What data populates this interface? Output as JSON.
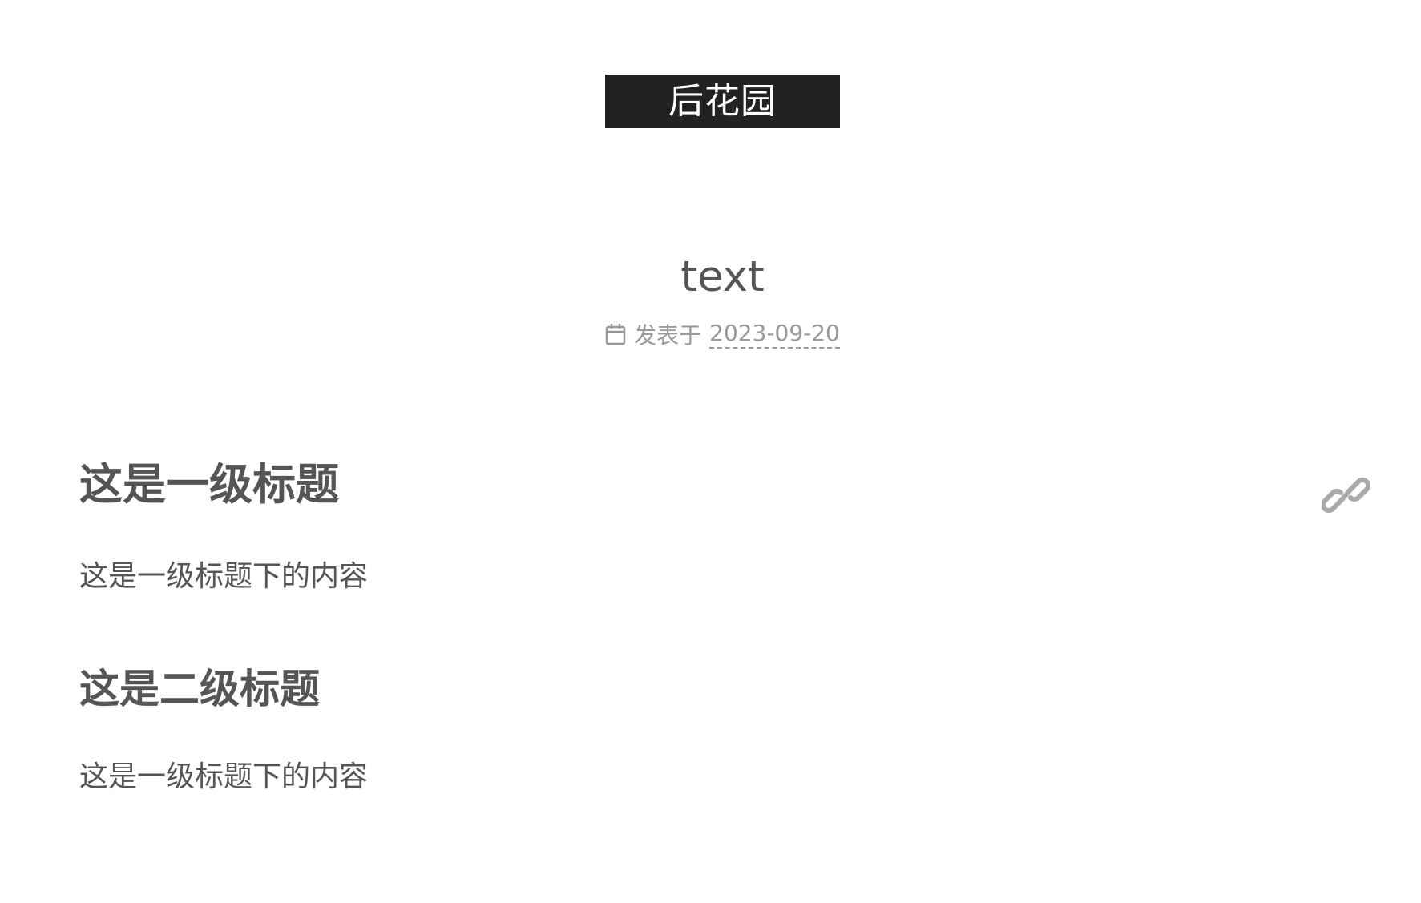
{
  "site": {
    "title": "后花园"
  },
  "post": {
    "title": "text",
    "meta_label": "发表于",
    "date": "2023-09-20"
  },
  "content": {
    "h1": "这是一级标题",
    "p1": "这是一级标题下的内容",
    "h2": "这是二级标题",
    "p2": "这是一级标题下的内容"
  },
  "icons": {
    "calendar": "calendar-icon",
    "link": "link-icon"
  },
  "colors": {
    "brand_bg": "#222222",
    "brand_text": "#ffffff",
    "text": "#555555",
    "meta": "#999999"
  }
}
